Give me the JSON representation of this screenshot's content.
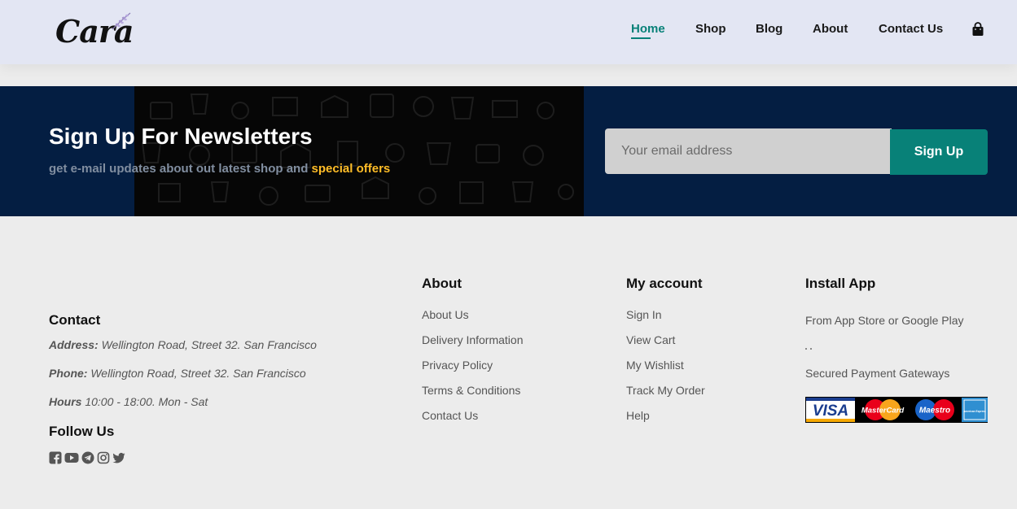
{
  "brand": {
    "logo_text": "Cara"
  },
  "nav": {
    "items": [
      {
        "label": "Home",
        "active": true
      },
      {
        "label": "Shop"
      },
      {
        "label": "Blog"
      },
      {
        "label": "About"
      },
      {
        "label": "Contact Us"
      }
    ],
    "cart_icon": "shopping-bag-icon"
  },
  "newsletter": {
    "title": "Sign Up For Newsletters",
    "subtitle": "get e-mail updates about out latest shop and",
    "subtitle_highlight": "special offers",
    "email_placeholder": "Your email address",
    "email_value": "",
    "button_label": "Sign Up"
  },
  "contact": {
    "heading": "Contact",
    "address_label": "Address:",
    "address_value": "Wellington Road, Street 32. San Francisco",
    "phone_label": "Phone:",
    "phone_value": "Wellington Road, Street 32. San Francisco",
    "hours_label": "Hours",
    "hours_value": "10:00 - 18:00. Mon - Sat",
    "follow_heading": "Follow Us",
    "social_icons": [
      "facebook-icon",
      "youtube-icon",
      "telegram-icon",
      "instagram-icon",
      "twitter-icon"
    ]
  },
  "about_col": {
    "heading": "About",
    "links": [
      "About Us",
      "Delivery Information",
      "Privacy Policy",
      "Terms & Conditions",
      "Contact Us"
    ]
  },
  "account_col": {
    "heading": "My account",
    "links": [
      "Sign In",
      "View Cart",
      "My Wishlist",
      "Track My Order",
      "Help"
    ]
  },
  "app_col": {
    "heading": "Install App",
    "store_text": "From App Store or Google Play",
    "payment_text": "Secured Payment Gateways",
    "payment_brands": [
      "VISA",
      "MasterCard",
      "Maestro",
      "American Express"
    ]
  },
  "colors": {
    "accent": "#088178",
    "header_bg": "#e3e6f3",
    "newsletter_bg": "#041e42",
    "highlight": "#ffbd27",
    "footer_bg": "#ececec"
  }
}
